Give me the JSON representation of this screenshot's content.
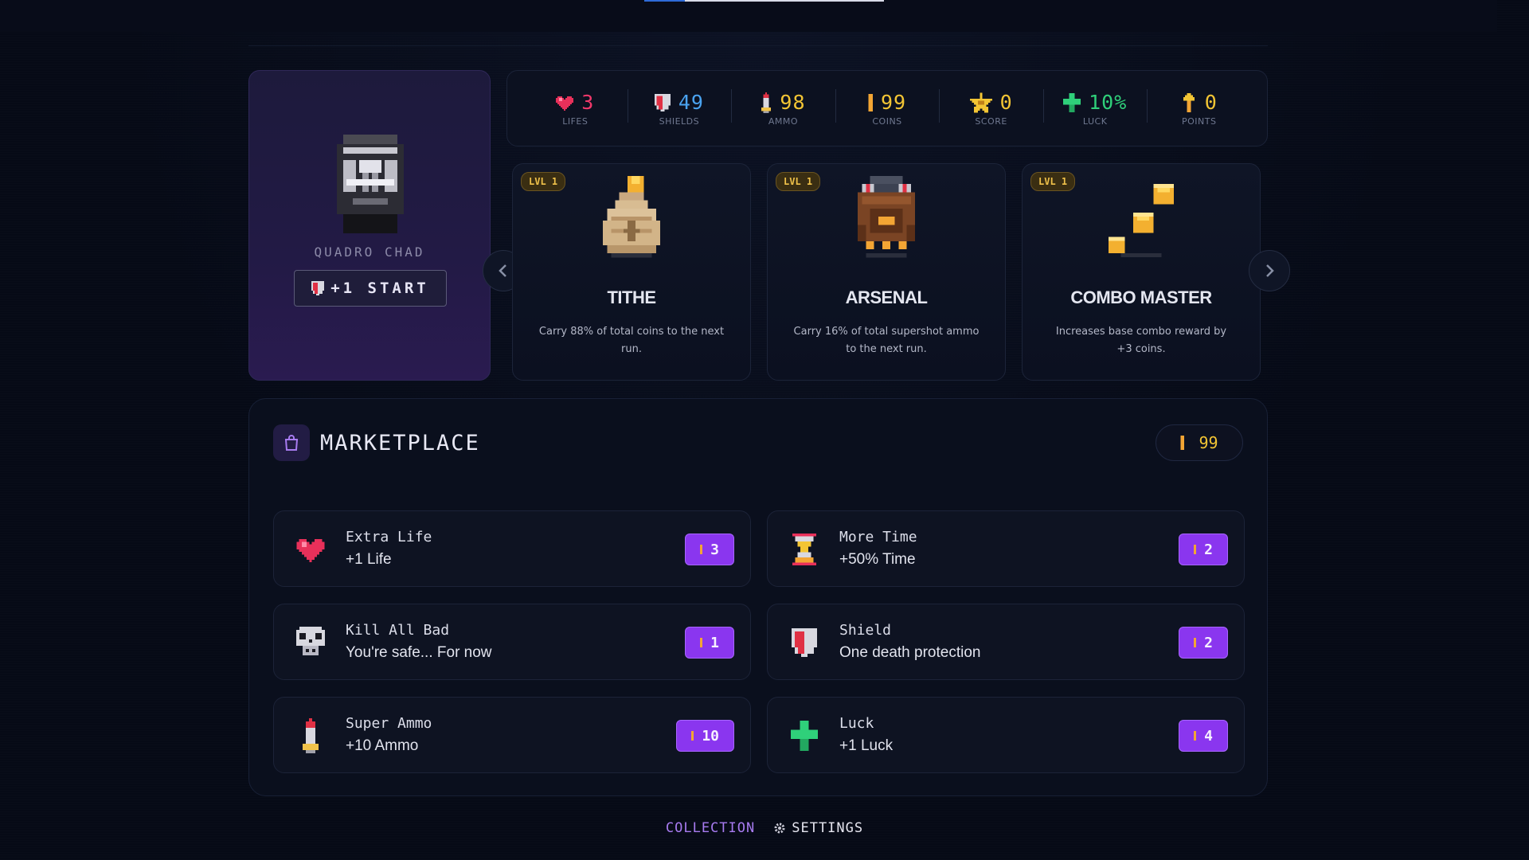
{
  "top_progress": 0.17,
  "character": {
    "name": "QUADRO CHAD",
    "start_label": "+1 START"
  },
  "stats": [
    {
      "icon": "heart-icon",
      "value": "3",
      "label": "LIFES",
      "color": "#f0386a"
    },
    {
      "icon": "shield-icon",
      "value": "49",
      "label": "SHIELDS",
      "color": "#4aa3f0"
    },
    {
      "icon": "bullet-icon",
      "value": "98",
      "label": "AMMO",
      "color": "#f3c534"
    },
    {
      "icon": "coin-icon",
      "value": "99",
      "label": "COINS",
      "color": "#f3c534"
    },
    {
      "icon": "star-icon",
      "value": "0",
      "label": "SCORE",
      "color": "#f3c534"
    },
    {
      "icon": "clover-icon",
      "value": "10%",
      "label": "LUCK",
      "color": "#2fd07a"
    },
    {
      "icon": "arrow-up-icon",
      "value": "0",
      "label": "POINTS",
      "color": "#f3c534"
    }
  ],
  "cards": [
    {
      "level": "LVL 1",
      "title": "TITHE",
      "description": "Carry 88% of total coins to the next run.",
      "art": "coin-sack-icon"
    },
    {
      "level": "LVL 1",
      "title": "ARSENAL",
      "description": "Carry 16% of total supershot ammo to the next run.",
      "art": "backpack-icon"
    },
    {
      "level": "LVL 1",
      "title": "COMBO MASTER",
      "description": "Increases base combo reward by +3 coins.",
      "art": "coin-stairs-icon"
    }
  ],
  "marketplace": {
    "title": "MARKETPLACE",
    "coins": "99",
    "items": [
      {
        "name": "Extra Life",
        "description": "+1 Life",
        "price": "3",
        "icon": "heart-icon"
      },
      {
        "name": "More Time",
        "description": "+50% Time",
        "price": "2",
        "icon": "hourglass-icon"
      },
      {
        "name": "Kill All Bad",
        "description": "You're safe... For now",
        "price": "1",
        "icon": "skull-icon"
      },
      {
        "name": "Shield",
        "description": "One death protection",
        "price": "2",
        "icon": "shield-icon"
      },
      {
        "name": "Super Ammo",
        "description": "+10 Ammo",
        "price": "10",
        "icon": "bullet-icon"
      },
      {
        "name": "Luck",
        "description": "+1 Luck",
        "price": "4",
        "icon": "clover-icon"
      }
    ]
  },
  "footer": {
    "collection": "COLLECTION",
    "settings": "SETTINGS"
  },
  "colors": {
    "accent_purple": "#8a36ef",
    "coin_gold": "#f3c534",
    "collection_link": "#a77bf0"
  }
}
